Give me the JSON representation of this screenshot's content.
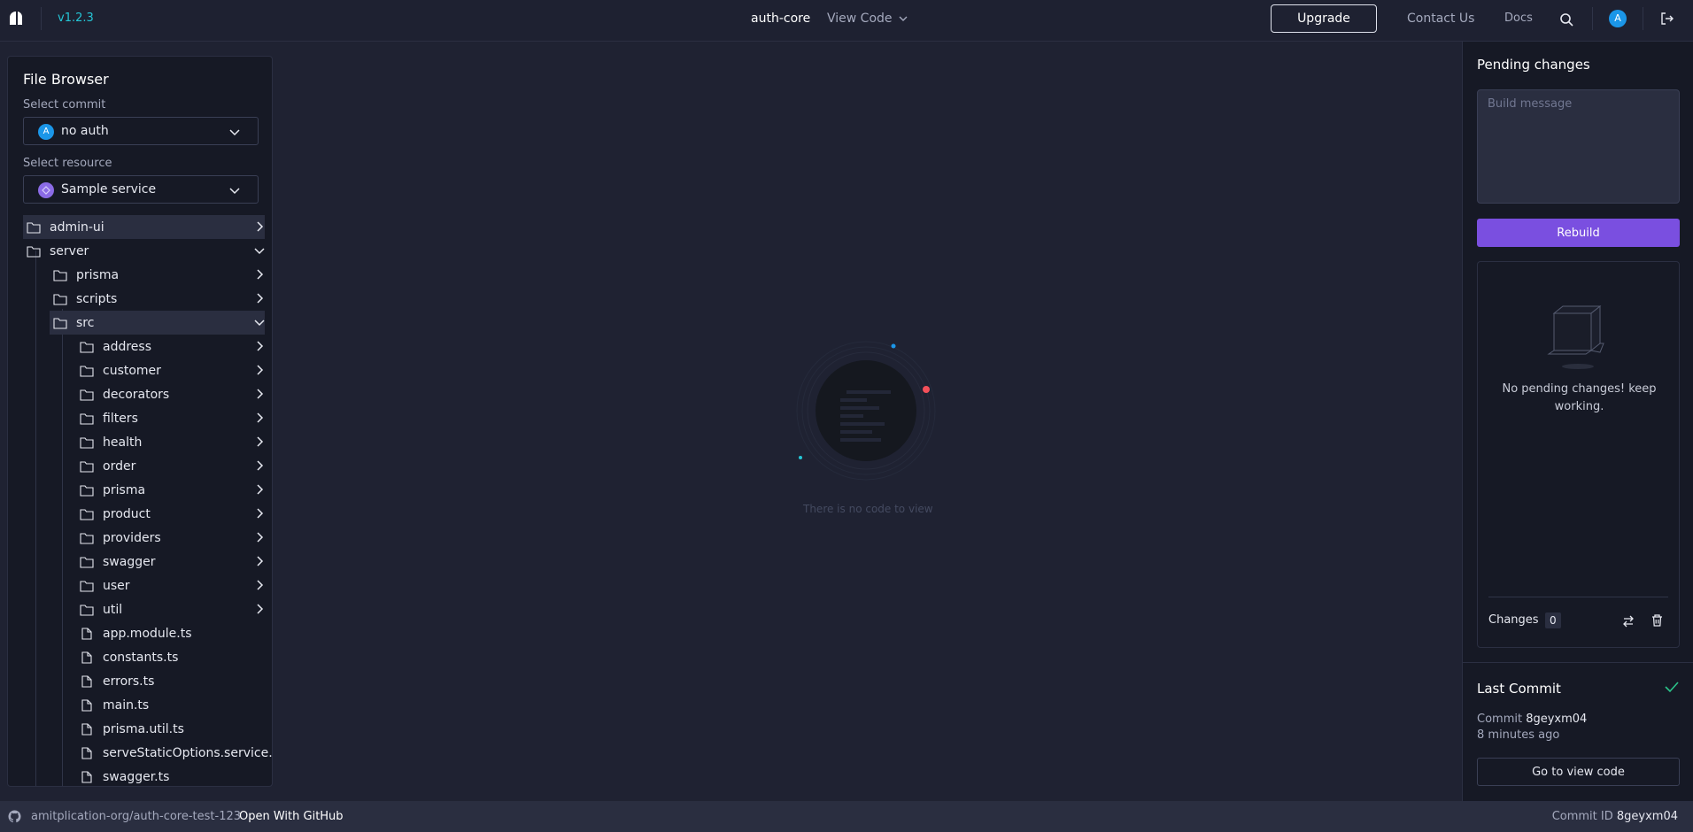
{
  "header": {
    "version": "v1.2.3",
    "repo": "auth-core",
    "view_code": "View Code",
    "upgrade": "Upgrade",
    "contact": "Contact Us",
    "docs": "Docs",
    "avatar_initial": "A"
  },
  "file_browser": {
    "title": "File Browser",
    "commit_label": "Select commit",
    "commit_value": "no auth",
    "commit_badge": "A",
    "resource_label": "Select resource",
    "resource_value": "Sample service",
    "tree": [
      {
        "label": "admin-ui",
        "type": "folder",
        "depth": 0,
        "expanded": false,
        "highlight": true
      },
      {
        "label": "server",
        "type": "folder",
        "depth": 0,
        "expanded": true,
        "highlight": false
      },
      {
        "label": "prisma",
        "type": "folder",
        "depth": 1,
        "expanded": false,
        "highlight": false
      },
      {
        "label": "scripts",
        "type": "folder",
        "depth": 1,
        "expanded": false,
        "highlight": false
      },
      {
        "label": "src",
        "type": "folder",
        "depth": 1,
        "expanded": true,
        "highlight": true
      },
      {
        "label": "address",
        "type": "folder",
        "depth": 2,
        "expanded": false,
        "highlight": false
      },
      {
        "label": "customer",
        "type": "folder",
        "depth": 2,
        "expanded": false,
        "highlight": false
      },
      {
        "label": "decorators",
        "type": "folder",
        "depth": 2,
        "expanded": false,
        "highlight": false
      },
      {
        "label": "filters",
        "type": "folder",
        "depth": 2,
        "expanded": false,
        "highlight": false
      },
      {
        "label": "health",
        "type": "folder",
        "depth": 2,
        "expanded": false,
        "highlight": false
      },
      {
        "label": "order",
        "type": "folder",
        "depth": 2,
        "expanded": false,
        "highlight": false
      },
      {
        "label": "prisma",
        "type": "folder",
        "depth": 2,
        "expanded": false,
        "highlight": false
      },
      {
        "label": "product",
        "type": "folder",
        "depth": 2,
        "expanded": false,
        "highlight": false
      },
      {
        "label": "providers",
        "type": "folder",
        "depth": 2,
        "expanded": false,
        "highlight": false
      },
      {
        "label": "swagger",
        "type": "folder",
        "depth": 2,
        "expanded": false,
        "highlight": false
      },
      {
        "label": "user",
        "type": "folder",
        "depth": 2,
        "expanded": false,
        "highlight": false
      },
      {
        "label": "util",
        "type": "folder",
        "depth": 2,
        "expanded": false,
        "highlight": false
      },
      {
        "label": "app.module.ts",
        "type": "file",
        "depth": 2,
        "highlight": false
      },
      {
        "label": "constants.ts",
        "type": "file",
        "depth": 2,
        "highlight": false
      },
      {
        "label": "errors.ts",
        "type": "file",
        "depth": 2,
        "highlight": false
      },
      {
        "label": "main.ts",
        "type": "file",
        "depth": 2,
        "highlight": false
      },
      {
        "label": "prisma.util.ts",
        "type": "file",
        "depth": 2,
        "highlight": false
      },
      {
        "label": "serveStaticOptions.service.ts",
        "type": "file",
        "depth": 2,
        "highlight": false
      },
      {
        "label": "swagger.ts",
        "type": "file",
        "depth": 2,
        "highlight": false
      }
    ]
  },
  "main": {
    "empty_text": "There is no code to view"
  },
  "pending": {
    "title": "Pending changes",
    "build_placeholder": "Build message",
    "rebuild": "Rebuild",
    "empty_message": "No pending changes! keep working.",
    "changes_label": "Changes",
    "changes_count": "0"
  },
  "last_commit": {
    "title": "Last Commit",
    "commit_prefix": "Commit",
    "commit_id": "8geyxm04",
    "time": "8 minutes ago",
    "go_to_code": "Go to view code"
  },
  "footer": {
    "repo_path": "amitplication-org/auth-core-test-123",
    "open_github": "Open With GitHub",
    "commit_id_label": "Commit ID",
    "commit_id": "8geyxm04"
  },
  "colors": {
    "accent": "#7a4fe0",
    "version": "#25c6d6",
    "avatar": "#1b96e8",
    "success": "#2bc48a",
    "error": "#f4505a"
  }
}
